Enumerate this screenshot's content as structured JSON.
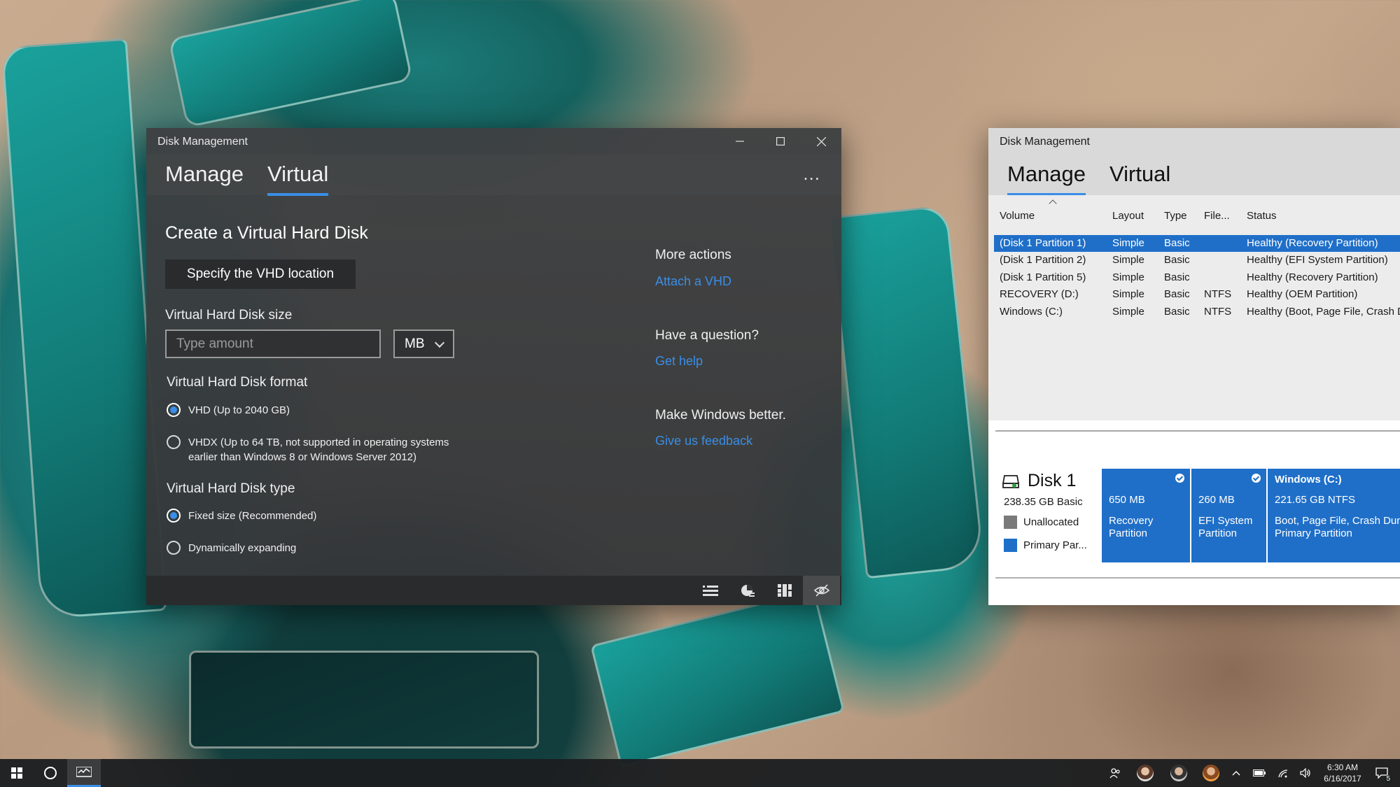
{
  "left_window": {
    "title": "Disk Management",
    "tabs": [
      {
        "label": "Manage"
      },
      {
        "label": "Virtual"
      }
    ],
    "more_label": "...",
    "heading": "Create a Virtual Hard Disk",
    "specify_button": "Specify the VHD location",
    "size_label": "Virtual Hard Disk size",
    "size_placeholder": "Type amount",
    "size_unit": "MB",
    "format_label": "Virtual Hard Disk format",
    "format_options": [
      {
        "line1": "VHD (Up to 2040 GB)",
        "line2": "",
        "selected": true
      },
      {
        "line1": "VHDX (Up to 64 TB, not supported in operating systems",
        "line2": "earlier than Windows 8 or Windows Server 2012)",
        "selected": false
      }
    ],
    "type_label": "Virtual Hard Disk type",
    "type_options": [
      {
        "label": "Fixed size (Recommended)",
        "selected": true
      },
      {
        "label": "Dynamically expanding",
        "selected": false
      }
    ],
    "side": {
      "more_actions": "More actions",
      "attach_link": "Attach a VHD",
      "question": "Have a question?",
      "help_link": "Get help",
      "better": "Make Windows better.",
      "feedback_link": "Give us feedback"
    },
    "status_icons": [
      "list-view-icon",
      "pie-chart-icon",
      "grid-view-icon",
      "hide-icon"
    ]
  },
  "right_window": {
    "title": "Disk Management",
    "tabs": [
      {
        "label": "Manage"
      },
      {
        "label": "Virtual"
      }
    ],
    "columns": [
      "Volume",
      "Layout",
      "Type",
      "File...",
      "Status"
    ],
    "rows": [
      {
        "volume": "(Disk 1 Partition 1)",
        "layout": "Simple",
        "type": "Basic",
        "fs": "",
        "status": "Healthy (Recovery Partition)"
      },
      {
        "volume": "(Disk 1 Partition 2)",
        "layout": "Simple",
        "type": "Basic",
        "fs": "",
        "status": "Healthy (EFI System Partition)"
      },
      {
        "volume": "(Disk 1 Partition 5)",
        "layout": "Simple",
        "type": "Basic",
        "fs": "",
        "status": "Healthy (Recovery Partition)"
      },
      {
        "volume": "RECOVERY (D:)",
        "layout": "Simple",
        "type": "Basic",
        "fs": "NTFS",
        "status": "Healthy (OEM Partition)"
      },
      {
        "volume": "Windows (C:)",
        "layout": "Simple",
        "type": "Basic",
        "fs": "NTFS",
        "status": "Healthy (Boot, Page File, Crash D"
      }
    ],
    "disk": {
      "name": "Disk 1",
      "size": "238.35 GB Basic",
      "legend": [
        {
          "label": "Unallocated",
          "color": "#7a7a7a"
        },
        {
          "label": "Primary Par...",
          "color": "#1f6fc8"
        }
      ],
      "partitions": [
        {
          "title": "",
          "size": "650 MB",
          "desc1": "Recovery",
          "desc2": "Partition"
        },
        {
          "title": "",
          "size": "260 MB",
          "desc1": "EFI System",
          "desc2": "Partition"
        },
        {
          "title": "Windows (C:)",
          "size": "221.65 GB NTFS",
          "desc1": "Boot, Page File, Crash Dun",
          "desc2": "Primary Partition"
        }
      ]
    }
  },
  "taskbar": {
    "time": "6:30 AM",
    "date": "6/16/2017",
    "notification_count": "5"
  },
  "colors": {
    "accent": "#3a8ee6",
    "selection": "#1f6fc8"
  }
}
